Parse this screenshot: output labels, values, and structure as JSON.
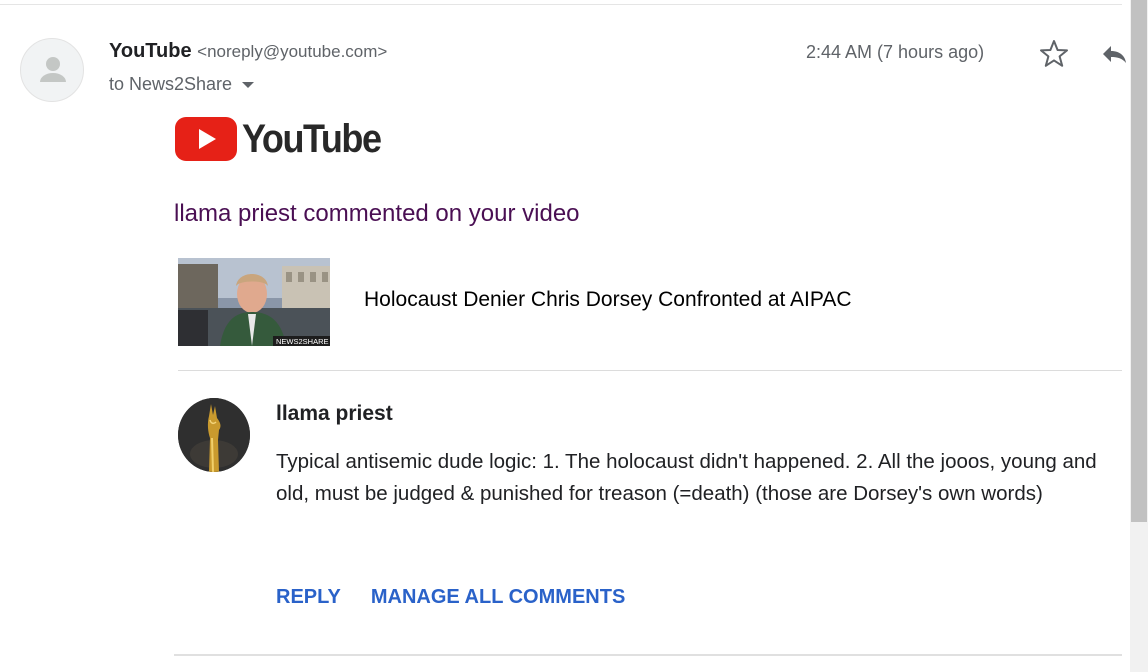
{
  "message": {
    "sender_name": "YouTube",
    "sender_email": "<noreply@youtube.com>",
    "to_line": "to News2Share",
    "timestamp": "2:44 AM (7 hours ago)",
    "star_icon": "star-outline-icon",
    "reply_icon": "reply-arrow-icon"
  },
  "email_body": {
    "brand_logo_text": "YouTube",
    "headline": "llama priest commented on your video",
    "video": {
      "title": "Holocaust Denier Chris Dorsey Confronted at AIPAC",
      "thumbnail_watermark": "NEWS2SHARE"
    },
    "comment": {
      "author": "llama priest",
      "text": "Typical antisemic dude logic: 1. The holocaust didn't happened. 2. All the jooos, young and old, must be judged & punished for treason (=death) (those are Dorsey's own words)"
    },
    "actions": {
      "reply_label": "REPLY",
      "manage_label": "MANAGE ALL COMMENTS"
    }
  },
  "colors": {
    "headline": "#4a0f53",
    "link": "#2a62c9",
    "brand_red": "#e62117"
  }
}
